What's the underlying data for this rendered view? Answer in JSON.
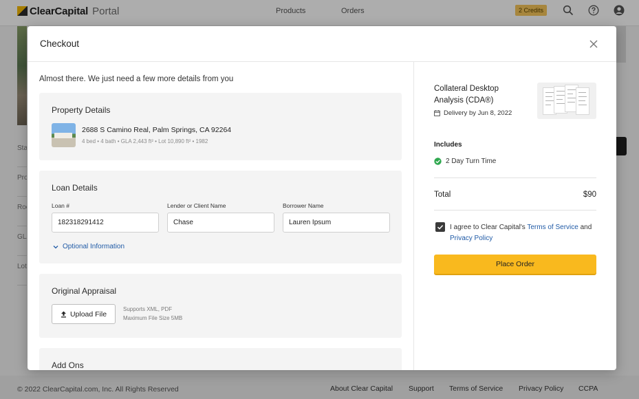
{
  "app": {
    "logo_brand": "ClearCapital",
    "logo_product": "Portal",
    "nav": [
      "Products",
      "Orders"
    ],
    "credits": "2 Credits"
  },
  "background": {
    "side_labels": [
      "Sta",
      "Pro",
      "Roo",
      "GLA",
      "Lot"
    ]
  },
  "modal": {
    "title": "Checkout",
    "intro": "Almost there. We just need a few more details from you",
    "property": {
      "title": "Property Details",
      "address": "2688 S Camino Real, Palm Springs, CA 92264",
      "details": "4 bed • 4 bath • GLA 2,443 ft² • Lot 10,890 ft² • 1982"
    },
    "loan": {
      "title": "Loan Details",
      "loan_label": "Loan #",
      "loan_value": "182318291412",
      "lender_label": "Lender or Client Name",
      "lender_value": "Chase",
      "borrower_label": "Borrower Name",
      "borrower_value": "Lauren Ipsum",
      "optional": "Optional Information"
    },
    "appraisal": {
      "title": "Original Appraisal",
      "upload": "Upload File",
      "supports": "Supports XML, PDF",
      "max_size": "Maximum File Size 5MB"
    },
    "addons": {
      "title": "Add Ons"
    },
    "summary": {
      "product_title": "Collateral Desktop Analysis (CDA®)",
      "delivery": "Delivery by Jun 8, 2022",
      "includes_title": "Includes",
      "include_item": "2 Day Turn Time",
      "total_label": "Total",
      "total_value": "$90",
      "agree_prefix": "I agree to Clear Capital's",
      "tos_link": "Terms of Service",
      "and_text": "and",
      "privacy_link": "Privacy Policy",
      "agreed": true,
      "place_order": "Place Order"
    }
  },
  "footer": {
    "copyright": "© 2022 ClearCapital.com, Inc. All Rights Reserved",
    "links": [
      "About Clear Capital",
      "Support",
      "Terms of Service",
      "Privacy Policy",
      "CCPA"
    ]
  },
  "colors": {
    "accent": "#f9b91e",
    "link": "#1f5aa6",
    "success": "#2fa84f",
    "credits_badge": "#f7c65a"
  },
  "icons": [
    "logo-mark-icon",
    "search-icon",
    "help-icon",
    "account-icon",
    "close-icon",
    "calendar-icon",
    "check-circle-icon",
    "chevron-down-icon",
    "upload-icon",
    "checkbox-checked-icon"
  ]
}
